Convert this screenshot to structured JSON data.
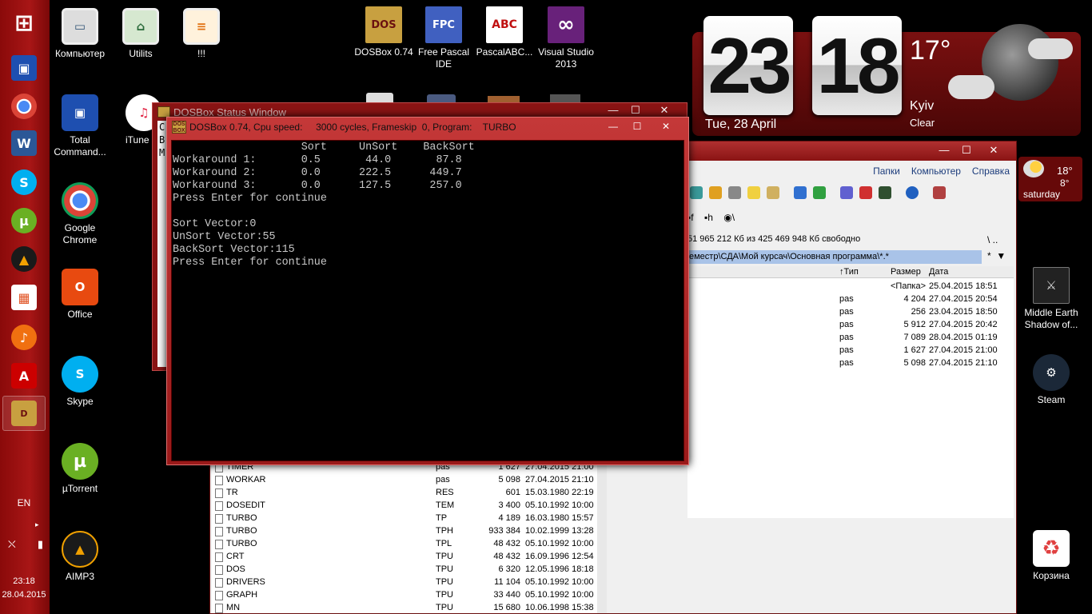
{
  "taskbar": {
    "language": "EN",
    "time": "23:18",
    "date": "28.04.2015",
    "tray_arrow": "▸",
    "apps": [
      {
        "icon": "windows-start-icon",
        "glyph": "⊞"
      },
      {
        "icon": "total-commander-icon",
        "glyph": "▣"
      },
      {
        "icon": "chrome-icon",
        "glyph": "◉"
      },
      {
        "icon": "word-icon",
        "glyph": "W"
      },
      {
        "icon": "skype-icon",
        "glyph": "S"
      },
      {
        "icon": "utorrent-icon",
        "glyph": "µ"
      },
      {
        "icon": "aimp-icon",
        "glyph": "▲"
      },
      {
        "icon": "apps-grid-icon",
        "glyph": "▦"
      },
      {
        "icon": "headphones-icon",
        "glyph": "♪"
      },
      {
        "icon": "acrobat-icon",
        "glyph": "A"
      },
      {
        "icon": "dosbox-icon",
        "glyph": "D"
      }
    ]
  },
  "desktop_icons": [
    {
      "label": "Компьютер",
      "icon": "computer-icon",
      "glyph": "▭"
    },
    {
      "label": "Utilits",
      "icon": "utilits-icon",
      "glyph": "⌂"
    },
    {
      "label": "!!!",
      "icon": "document-icon",
      "glyph": "≡"
    },
    {
      "label": "Total Command...",
      "icon": "total-commander-icon",
      "glyph": "▣"
    },
    {
      "label": "iTune",
      "icon": "itunes-icon",
      "glyph": "♫"
    },
    {
      "label": "Google Chrome",
      "icon": "chrome-icon",
      "glyph": "◉"
    },
    {
      "label": "Office",
      "icon": "office-icon",
      "glyph": "O"
    },
    {
      "label": "Skype",
      "icon": "skype-icon",
      "glyph": "S"
    },
    {
      "label": "µTorrent",
      "icon": "utorrent-icon",
      "glyph": "µ"
    },
    {
      "label": "AIMP3",
      "icon": "aimp-icon",
      "glyph": "▲"
    },
    {
      "label": "DOSBox 0.74",
      "icon": "dosbox-icon",
      "glyph": "DOS"
    },
    {
      "label": "Free Pascal IDE",
      "icon": "free-pascal-icon",
      "glyph": "FPC"
    },
    {
      "label": "PascalABC...",
      "icon": "pascalabc-icon",
      "glyph": "ABC"
    },
    {
      "label": "Visual Studio 2013",
      "icon": "visual-studio-icon",
      "glyph": "∞"
    },
    {
      "label": "Middle Earth Shadow of...",
      "icon": "middle-earth-icon",
      "glyph": "⚔"
    },
    {
      "label": "Steam",
      "icon": "steam-icon",
      "glyph": "⚙"
    },
    {
      "label": "Корзина",
      "icon": "recycle-bin-icon",
      "glyph": "♻"
    }
  ],
  "clock_widget": {
    "hours": "23",
    "minutes": "18",
    "date": "Tue, 28 April",
    "temperature": "17°",
    "city": "Kyiv",
    "condition": "Clear"
  },
  "weather_gadget": {
    "high": "18°",
    "low": "8°",
    "day": "saturday"
  },
  "total_commander": {
    "menu": [
      "Папки",
      "Компьютер",
      "Справка"
    ],
    "drives": [
      "f",
      "h",
      "\\"
    ],
    "free_space": "51 965 212 Кб из 425 469 948 Кб свободно",
    "updir_label": "\\    ..",
    "path": "еместр\\СДА\\Мой курсач\\Основная программа\\*.*",
    "filter_label": "*",
    "columns": {
      "type": "↑Тип",
      "size": "Размер",
      "date": "Дата"
    },
    "right_rows": [
      {
        "type": "",
        "size": "<Папка>",
        "date": "25.04.2015 18:51"
      },
      {
        "type": "pas",
        "size": "4 204",
        "date": "27.04.2015 20:54"
      },
      {
        "type": "pas",
        "size": "256",
        "date": "23.04.2015 18:50"
      },
      {
        "type": "pas",
        "size": "5 912",
        "date": "27.04.2015 20:42"
      },
      {
        "type": "pas",
        "size": "7 089",
        "date": "28.04.2015 01:19"
      },
      {
        "type": "pas",
        "size": "1 627",
        "date": "27.04.2015 21:00"
      },
      {
        "type": "pas",
        "size": "5 098",
        "date": "27.04.2015 21:10"
      }
    ],
    "left_rows": [
      {
        "name": "TIMER",
        "ext": "pas",
        "size": "1 627",
        "date": "27.04.2015 21:00"
      },
      {
        "name": "WORKAR",
        "ext": "pas",
        "size": "5 098",
        "date": "27.04.2015 21:10"
      },
      {
        "name": "TR",
        "ext": "RES",
        "size": "601",
        "date": "15.03.1980 22:19"
      },
      {
        "name": "DOSEDIT",
        "ext": "TEM",
        "size": "3 400",
        "date": "05.10.1992 10:00"
      },
      {
        "name": "TURBO",
        "ext": "TP",
        "size": "4 189",
        "date": "16.03.1980 15:57"
      },
      {
        "name": "TURBO",
        "ext": "TPH",
        "size": "933 384",
        "date": "10.02.1999 13:28"
      },
      {
        "name": "TURBO",
        "ext": "TPL",
        "size": "48 432",
        "date": "05.10.1992 10:00"
      },
      {
        "name": "CRT",
        "ext": "TPU",
        "size": "48 432",
        "date": "16.09.1996 12:54"
      },
      {
        "name": "DOS",
        "ext": "TPU",
        "size": "6 320",
        "date": "12.05.1996 18:18"
      },
      {
        "name": "DRIVERS",
        "ext": "TPU",
        "size": "11 104",
        "date": "05.10.1992 10:00"
      },
      {
        "name": "GRAPH",
        "ext": "TPU",
        "size": "33 440",
        "date": "05.10.1992 10:00"
      },
      {
        "name": "MN",
        "ext": "TPU",
        "size": "15 680",
        "date": "10.06.1998 15:38"
      }
    ]
  },
  "dosbox_status": {
    "title": "DOSBox Status Window",
    "fragment": "C\nB\nM"
  },
  "dosbox": {
    "title": "DOSBox 0.74, Cpu speed:     3000 cycles, Frameskip  0, Program:    TURBO",
    "logo": "DOS\nBOX",
    "screen": "                    Sort     UnSort    BackSort\nWorkaround 1:       0.5       44.0       87.8\nWorkaround 2:       0.0      222.5      449.7\nWorkaround 3:       0.0      127.5      257.0\nPress Enter for continue\n\nSort Vector:0\nUnSort Vector:55\nBackSort Vector:115\nPress Enter for continue"
  },
  "window_buttons": {
    "minimize": "—",
    "maximize": "☐",
    "close": "✕"
  },
  "colors": {
    "taskbar": "#a81616",
    "window_frame": "#c43838",
    "dos_text": "#c8c8c8",
    "tc_path": "#a9c3e8"
  }
}
